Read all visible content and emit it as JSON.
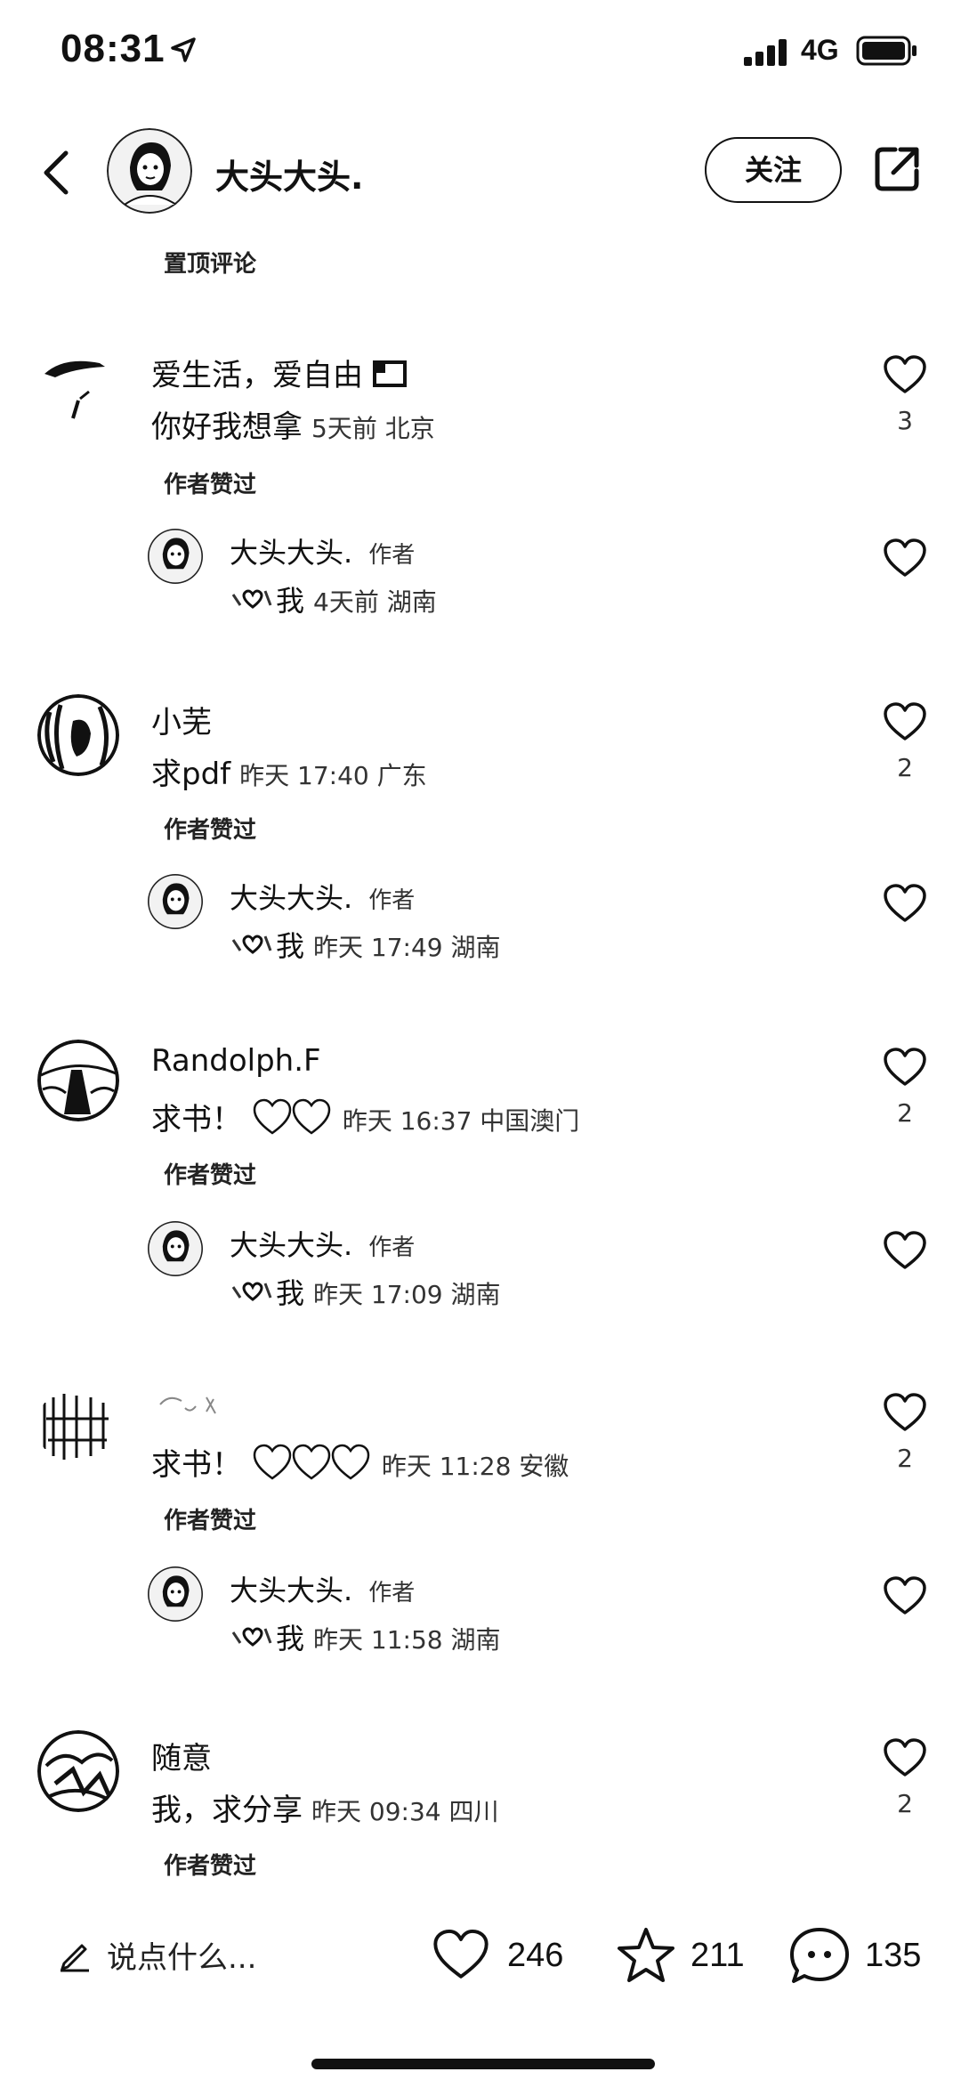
{
  "status_bar": {
    "time": "08:31",
    "network": "4G"
  },
  "header": {
    "username": "大头大头.",
    "follow_label": "关注"
  },
  "pinned_label": "置顶评论",
  "comments": [
    {
      "name": "爱生活，爱自由",
      "text": "你好我想拿",
      "meta": "5天前 北京",
      "likes": "3",
      "author_liked": "作者赞过",
      "reply": {
        "name": "大头大头.",
        "tag": "作者",
        "text": "我",
        "meta": "4天前 湖南"
      }
    },
    {
      "name": "小芜",
      "text": "求pdf",
      "meta": "昨天 17:40 广东",
      "likes": "2",
      "author_liked": "作者赞过",
      "reply": {
        "name": "大头大头.",
        "tag": "作者",
        "text": "我",
        "meta": "昨天 17:49 湖南"
      }
    },
    {
      "name": "Randolph.F",
      "text": "求书！",
      "meta": "昨天 16:37 中国澳门",
      "likes": "2",
      "author_liked": "作者赞过",
      "reply": {
        "name": "大头大头.",
        "tag": "作者",
        "text": "我",
        "meta": "昨天 17:09 湖南"
      }
    },
    {
      "name": "",
      "text": "求书！",
      "meta": "昨天 11:28 安徽",
      "likes": "2",
      "author_liked": "作者赞过",
      "reply": {
        "name": "大头大头.",
        "tag": "作者",
        "text": "我",
        "meta": "昨天 11:58 湖南"
      }
    },
    {
      "name": "随意",
      "text": "我，求分享",
      "meta": "昨天 09:34 四川",
      "likes": "2",
      "author_liked": "作者赞过"
    }
  ],
  "bottom_bar": {
    "input_placeholder": "说点什么...",
    "likes": "246",
    "favorites": "211",
    "comments": "135"
  }
}
